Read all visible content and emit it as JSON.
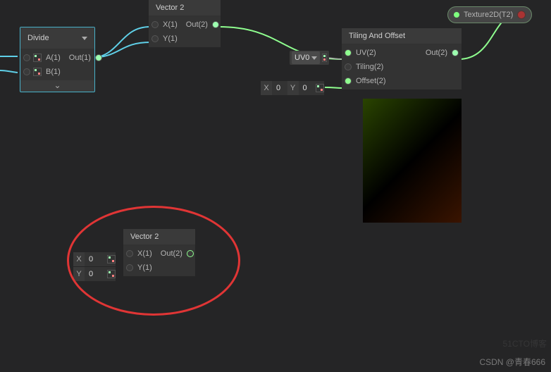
{
  "nodes": {
    "divide": {
      "title": "Divide",
      "ports": {
        "a": "A(1)",
        "b": "B(1)",
        "out": "Out(1)"
      }
    },
    "vector2_top": {
      "title": "Vector 2",
      "ports": {
        "x": "X(1)",
        "y": "Y(1)",
        "out": "Out(2)"
      }
    },
    "tiling": {
      "title": "Tiling And Offset",
      "ports": {
        "uv": "UV(2)",
        "tiling": "Tiling(2)",
        "offset": "Offset(2)",
        "out": "Out(2)"
      }
    },
    "vector2_bottom": {
      "title": "Vector 2",
      "ports": {
        "x": "X(1)",
        "y": "Y(1)",
        "out": "Out(2)"
      }
    }
  },
  "fields": {
    "uv_selector": "UV0",
    "offset_x": {
      "label": "X",
      "value": "0"
    },
    "offset_y": {
      "label": "Y",
      "value": "0"
    },
    "v2_x": {
      "label": "X",
      "value": "0"
    },
    "v2_y": {
      "label": "Y",
      "value": "0"
    }
  },
  "texture2d": {
    "label": "Texture2D(T2)"
  },
  "watermark": "CSDN @青春666",
  "watermark2": "51CTO博客"
}
